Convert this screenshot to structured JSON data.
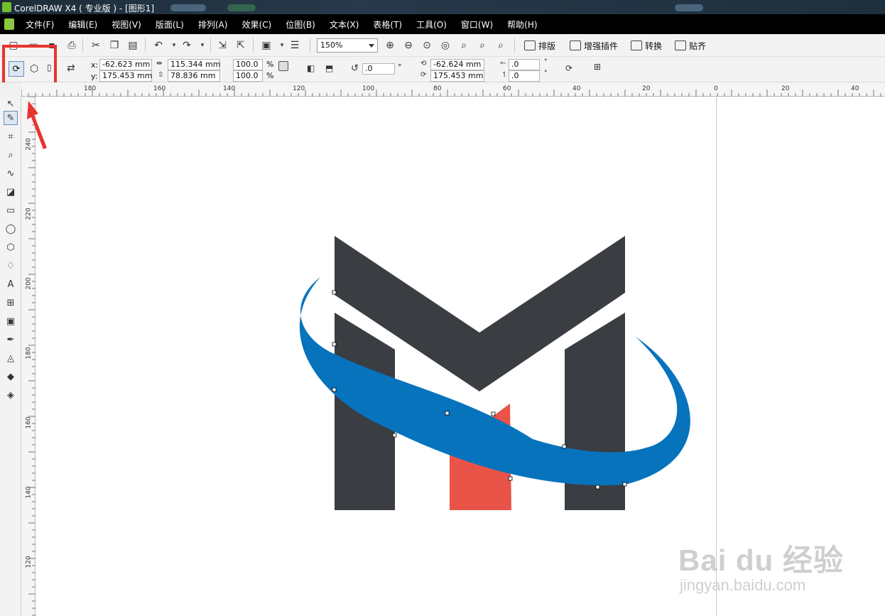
{
  "window": {
    "title": "CorelDRAW X4 ( 专业版 ) - [图形1]"
  },
  "menu": [
    "文件(F)",
    "编辑(E)",
    "视图(V)",
    "版面(L)",
    "排列(A)",
    "效果(C)",
    "位图(B)",
    "文本(X)",
    "表格(T)",
    "工具(O)",
    "窗口(W)",
    "帮助(H)"
  ],
  "toolbar": {
    "zoom": "150%",
    "layout_label": "排版",
    "plugins_label": "增强插件",
    "convert_label": "转换",
    "snap_label": "贴齐"
  },
  "propbar": {
    "x_label": "x:",
    "y_label": "y:",
    "x": "-62.623 mm",
    "y": "175.453 mm",
    "width": "115.344 mm",
    "height": "78.836 mm",
    "scale_x": "100.0",
    "scale_y": "100.0",
    "pct": "%",
    "rotation": ".0",
    "degree": "°",
    "center_x": "-62.624 mm",
    "center_y": "175.453 mm",
    "skew_h": ".0",
    "skew_v": ".0"
  },
  "ruler": {
    "top_labels": [
      "180",
      "160",
      "140",
      "120",
      "100",
      "80",
      "60",
      "40",
      "20",
      "0",
      "20",
      "40"
    ],
    "left_labels": [
      "240",
      "220",
      "200",
      "180",
      "160",
      "140",
      "120"
    ]
  },
  "logo_colors": {
    "dark": "#3a3d42",
    "blue": "#0773bd",
    "red": "#ea5348"
  },
  "watermark": {
    "brand": "Bai du 经验",
    "url": "jingyan.baidu.com"
  },
  "colors": {
    "highlight": "#e8342f",
    "menubar": "#000000"
  }
}
